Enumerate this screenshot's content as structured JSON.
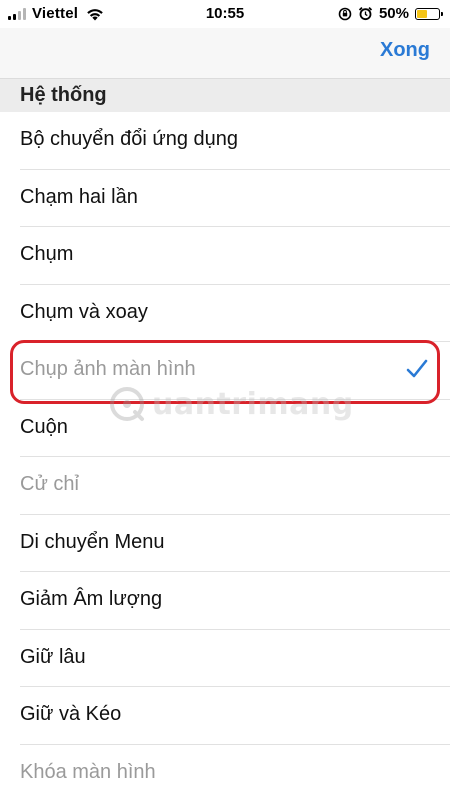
{
  "status_bar": {
    "carrier": "Viettel",
    "time": "10:55",
    "battery_percent": "50%",
    "battery_level": 0.5,
    "icons": [
      "signal-icon",
      "wifi-icon",
      "orientation-lock-icon",
      "alarm-icon",
      "battery-icon"
    ]
  },
  "nav": {
    "done_label": "Xong"
  },
  "section": {
    "title": "Hệ thống"
  },
  "items": [
    {
      "label": "Bộ chuyển đổi ứng dụng",
      "disabled": false,
      "selected": false
    },
    {
      "label": "Chạm hai lần",
      "disabled": false,
      "selected": false
    },
    {
      "label": "Chụm",
      "disabled": false,
      "selected": false
    },
    {
      "label": "Chụm và xoay",
      "disabled": false,
      "selected": false
    },
    {
      "label": "Chụp ảnh màn hình",
      "disabled": true,
      "selected": true
    },
    {
      "label": "Cuộn",
      "disabled": false,
      "selected": false
    },
    {
      "label": "Cử chỉ",
      "disabled": true,
      "selected": false
    },
    {
      "label": "Di chuyển Menu",
      "disabled": false,
      "selected": false
    },
    {
      "label": "Giảm Âm lượng",
      "disabled": false,
      "selected": false
    },
    {
      "label": "Giữ lâu",
      "disabled": false,
      "selected": false
    },
    {
      "label": "Giữ và Kéo",
      "disabled": false,
      "selected": false
    },
    {
      "label": "Khóa màn hình",
      "disabled": true,
      "selected": false
    }
  ],
  "watermark": {
    "text": "uantrimang"
  },
  "colors": {
    "accent": "#2a7ad5",
    "highlight_border": "#d9222a",
    "battery": "#f5c518"
  }
}
